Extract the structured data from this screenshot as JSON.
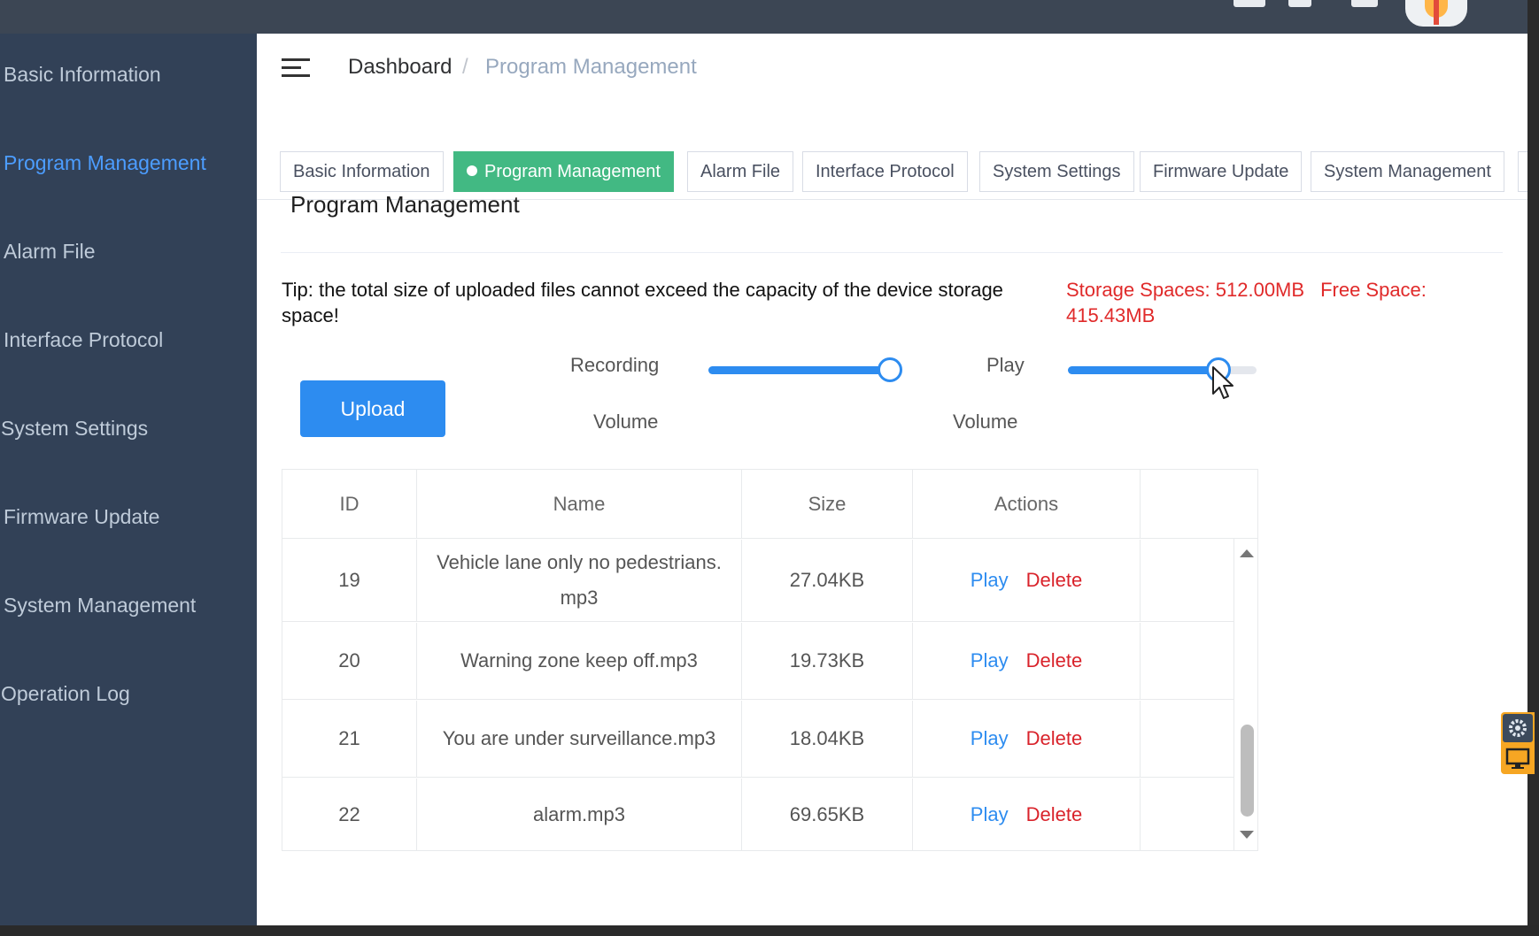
{
  "sidebar": {
    "items": [
      {
        "label": "Basic Information"
      },
      {
        "label": "Program Management"
      },
      {
        "label": "Alarm File"
      },
      {
        "label": "Interface Protocol"
      },
      {
        "label": "System Settings"
      },
      {
        "label": "Firmware Update"
      },
      {
        "label": "System Management"
      },
      {
        "label": "Operation Log"
      }
    ],
    "active_index": 1
  },
  "breadcrumb": {
    "root": "Dashboard",
    "separator": "/",
    "current": "Program Management"
  },
  "tags": [
    {
      "label": "Basic Information"
    },
    {
      "label": "Program Management"
    },
    {
      "label": "Alarm File"
    },
    {
      "label": "Interface Protocol"
    },
    {
      "label": "System Settings"
    },
    {
      "label": "Firmware Update"
    },
    {
      "label": "System Management"
    }
  ],
  "main": {
    "title": "Program Management",
    "tip": "Tip: the total size of uploaded files cannot exceed the capacity of the device storage space!",
    "storage_spaces": "Storage Spaces: 512.00MB",
    "free_space": "Free Space: 415.43MB",
    "upload_label": "Upload",
    "recording_label_1": "Recording",
    "recording_label_2": "Volume",
    "play_label_1": "Play",
    "play_label_2": "Volume",
    "recording_volume_fraction": 1.0,
    "play_volume_fraction": 0.8
  },
  "table": {
    "columns": {
      "id": "ID",
      "name": "Name",
      "size": "Size",
      "actions": "Actions"
    },
    "rows": [
      {
        "id": "19",
        "name": "Vehicle lane only no pedestrians.mp3",
        "size": "27.04KB",
        "play": "Play",
        "delete": "Delete"
      },
      {
        "id": "20",
        "name": "Warning zone keep off.mp3",
        "size": "19.73KB",
        "play": "Play",
        "delete": "Delete"
      },
      {
        "id": "21",
        "name": "You are under surveillance.mp3",
        "size": "18.04KB",
        "play": "Play",
        "delete": "Delete"
      },
      {
        "id": "22",
        "name": "alarm.mp3",
        "size": "69.65KB",
        "play": "Play",
        "delete": "Delete"
      }
    ]
  },
  "colors": {
    "sidebar_bg": "#324157",
    "sidebar_text": "#bfcbd9",
    "sidebar_active": "#4c9dff",
    "active_tag": "#42b983",
    "primary": "#2d8cf0",
    "danger": "#d9232b",
    "storage_text": "#e02a2a"
  },
  "icons": {
    "menu_toggle": "hamburger-icon",
    "scroll_up": "triangle-up-icon",
    "scroll_down": "triangle-down-icon",
    "cursor": "mouse-pointer-icon",
    "widget_top": "gear-icon",
    "widget_bottom": "monitor-icon"
  }
}
